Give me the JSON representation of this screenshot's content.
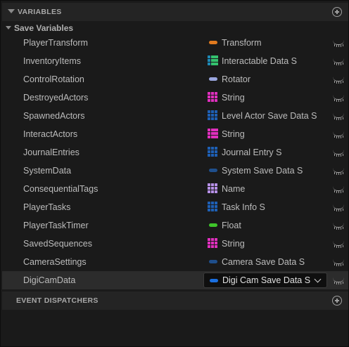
{
  "variables_header": {
    "title": "VARIABLES",
    "add_icon": "add-circle-icon"
  },
  "category": {
    "label": "Save Variables"
  },
  "colors": {
    "transform": "#e07a1f",
    "struct": "#1e5fb4",
    "rotator": "#9aa6df",
    "string": "#e02fbe",
    "name": "#b690e6",
    "float": "#3ec42a",
    "struct_light": "#1f4f8c"
  },
  "rows": [
    {
      "name": "PlayerTransform",
      "type": "Transform",
      "icon": "pill",
      "color": "#e07a1f"
    },
    {
      "name": "InventoryItems",
      "type": "Interactable Data S",
      "icon": "map",
      "color": "#1e88b4",
      "color2": "#34c16e"
    },
    {
      "name": "ControlRotation",
      "type": "Rotator",
      "icon": "pill",
      "color": "#9aa6df"
    },
    {
      "name": "DestroyedActors",
      "type": "String",
      "icon": "grid",
      "color": "#e02fbe"
    },
    {
      "name": "SpawnedActors",
      "type": "Level Actor Save Data S",
      "icon": "grid",
      "color": "#1e5fb4"
    },
    {
      "name": "InteractActors",
      "type": "String",
      "icon": "map",
      "color": "#e02fbe",
      "color2": "#e02fbe"
    },
    {
      "name": "JournalEntries",
      "type": "Journal Entry S",
      "icon": "grid",
      "color": "#1e5fb4"
    },
    {
      "name": "SystemData",
      "type": "System Save Data S",
      "icon": "pill",
      "color": "#1f4f8c"
    },
    {
      "name": "ConsequentialTags",
      "type": "Name",
      "icon": "grid",
      "color": "#b690e6"
    },
    {
      "name": "PlayerTasks",
      "type": "Task Info S",
      "icon": "grid",
      "color": "#1e5fb4"
    },
    {
      "name": "PlayerTaskTimer",
      "type": "Float",
      "icon": "pill",
      "color": "#3ec42a"
    },
    {
      "name": "SavedSequences",
      "type": "String",
      "icon": "grid",
      "color": "#e02fbe"
    },
    {
      "name": "CameraSettings",
      "type": "Camera Save Data S",
      "icon": "pill",
      "color": "#1f4f8c"
    }
  ],
  "selected_row": {
    "name": "DigiCamData",
    "type": "Digi Cam Save Data S",
    "icon": "pill",
    "color": "#1a6fe0"
  },
  "event_dispatchers_header": {
    "title": "EVENT DISPATCHERS",
    "add_icon": "add-circle-icon"
  }
}
